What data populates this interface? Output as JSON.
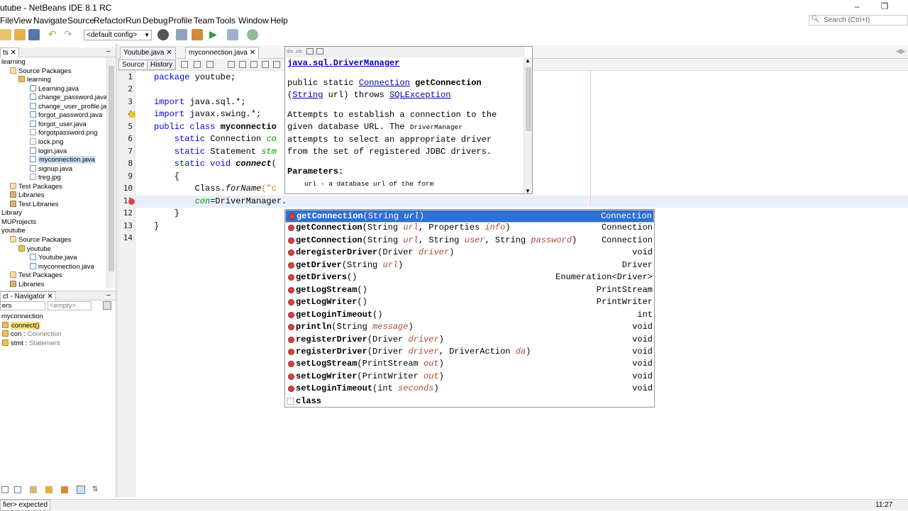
{
  "window": {
    "title": "utube - NetBeans IDE 8.1 RC"
  },
  "menu": [
    "File",
    "View",
    "Navigate",
    "Source",
    "Refactor",
    "Run",
    "Debug",
    "Profile",
    "Team",
    "Tools",
    "Window",
    "Help"
  ],
  "search": {
    "placeholder": "Search (Ctrl+I)"
  },
  "toolbar": {
    "config": "<default config>"
  },
  "projects_panel": {
    "tab": "ts",
    "tree": [
      {
        "label": "learning",
        "icon": "none",
        "indent": 0
      },
      {
        "label": "Source Packages",
        "icon": "package-folder-icon",
        "indent": 1
      },
      {
        "label": "learning",
        "icon": "package-icon",
        "indent": 2
      },
      {
        "label": "Learning.java",
        "icon": "java-file-icon",
        "indent": 3
      },
      {
        "label": "change_password.java",
        "icon": "java-file-icon",
        "indent": 3
      },
      {
        "label": "change_user_profile.java",
        "icon": "java-file-icon",
        "indent": 3
      },
      {
        "label": "forgot_password.java",
        "icon": "java-file-icon",
        "indent": 3
      },
      {
        "label": "forgot_user.java",
        "icon": "java-file-icon",
        "indent": 3
      },
      {
        "label": "forgotpassword.png",
        "icon": "image-file-icon",
        "indent": 3
      },
      {
        "label": "lock.png",
        "icon": "image-file-icon",
        "indent": 3
      },
      {
        "label": "login.java",
        "icon": "java-file-icon",
        "indent": 3
      },
      {
        "label": "myconnection.java",
        "icon": "java-file-icon",
        "indent": 3,
        "selected": true
      },
      {
        "label": "signup.java",
        "icon": "java-file-icon",
        "indent": 3
      },
      {
        "label": "treg.jpg",
        "icon": "image-file-icon",
        "indent": 3
      },
      {
        "label": "Test Packages",
        "icon": "package-folder-icon",
        "indent": 1
      },
      {
        "label": "Libraries",
        "icon": "library-icon",
        "indent": 1
      },
      {
        "label": "Test Libraries",
        "icon": "library-icon",
        "indent": 1
      },
      {
        "label": "Library",
        "icon": "none",
        "indent": 0
      },
      {
        "label": "MUProjects",
        "icon": "none",
        "indent": 0
      },
      {
        "label": "youtube",
        "icon": "none",
        "indent": 0
      },
      {
        "label": "Source Packages",
        "icon": "package-folder-icon",
        "indent": 1
      },
      {
        "label": "youtube",
        "icon": "package-icon",
        "indent": 2
      },
      {
        "label": "Youtube.java",
        "icon": "java-file-icon",
        "indent": 3
      },
      {
        "label": "myconnection.java",
        "icon": "java-file-icon",
        "indent": 3
      },
      {
        "label": "Test Packages",
        "icon": "package-folder-icon",
        "indent": 1
      },
      {
        "label": "Libraries",
        "icon": "library-icon",
        "indent": 1
      }
    ]
  },
  "navigator": {
    "tab": "ct - Navigator",
    "filter1": "ers",
    "filter2": "<empty>",
    "items": [
      {
        "label": "myconnection",
        "type": "",
        "indent": 0
      },
      {
        "label": "connect()",
        "type": "",
        "indent": 1,
        "highlight": true
      },
      {
        "label": "con :",
        "type": "Connection",
        "indent": 1
      },
      {
        "label": "stmt :",
        "type": "Statement",
        "indent": 1
      }
    ]
  },
  "editor": {
    "tabs": [
      {
        "label": "Youtube.java",
        "active": false
      },
      {
        "label": "myconnection.java",
        "active": true
      }
    ],
    "source_label": "Source",
    "history_label": "History",
    "lines": [
      "1",
      "2",
      "3",
      "4",
      "5",
      "6",
      "7",
      "8",
      "9",
      "10",
      "11",
      "12",
      "13",
      "14"
    ],
    "code": {
      "l1a": "package",
      "l1b": " youtube;",
      "l3a": "import",
      "l3b": " java.sql.*;",
      "l4a": "import",
      "l4b": " javax.swing.*;",
      "l5a": "public class",
      "l5b": " ",
      "l5c": "myconnectio",
      "l6a": "    static",
      "l6b": " Connection ",
      "l6c": "co",
      "l7a": "    static",
      "l7b": " Statement ",
      "l7c": "stm",
      "l8a": "    static void",
      "l8b": " ",
      "l8c": "connect",
      "l8d": "(",
      "l9": "    {",
      "l10a": "        Class.",
      "l10b": "forName",
      "l10c": "(\"c",
      "l11a": "        ",
      "l11b": "con",
      "l11c": "=DriverManager.",
      "l12": "    }",
      "l13": "}"
    }
  },
  "javadoc": {
    "class_link": "java.sql.DriverManager",
    "sig1": "public static ",
    "sig_link1": "Connection",
    "sig_name": " getConnection",
    "sig2a": "(",
    "sig_link2": "String",
    "sig2b": " url) throws ",
    "sig_link3": "SQLException",
    "desc1": "Attempts to establish a connection to the",
    "desc2a": "given database URL. The ",
    "desc2b": "DriverManager",
    "desc3": "attempts to select an appropriate driver",
    "desc4": "from the set of registered JDBC drivers.",
    "params_title": "Parameters:",
    "param1a": "url",
    "param1b": " - a database url of the form"
  },
  "completion": [
    {
      "name": "getConnection",
      "params": [
        [
          "String ",
          "url"
        ]
      ],
      "ret": "Connection",
      "selected": true
    },
    {
      "name": "getConnection",
      "params": [
        [
          "String ",
          "url"
        ],
        [
          "Properties ",
          "info"
        ]
      ],
      "ret": "Connection"
    },
    {
      "name": "getConnection",
      "params": [
        [
          "String ",
          "url"
        ],
        [
          "String ",
          "user"
        ],
        [
          "String ",
          "password"
        ]
      ],
      "ret": "Connection"
    },
    {
      "name": "deregisterDriver",
      "params": [
        [
          "Driver ",
          "driver"
        ]
      ],
      "ret": "void"
    },
    {
      "name": "getDriver",
      "params": [
        [
          "String ",
          "url"
        ]
      ],
      "ret": "Driver"
    },
    {
      "name": "getDrivers",
      "params": [],
      "ret": "Enumeration<Driver>"
    },
    {
      "name": "getLogStream",
      "params": [],
      "ret": "PrintStream"
    },
    {
      "name": "getLogWriter",
      "params": [],
      "ret": "PrintWriter"
    },
    {
      "name": "getLoginTimeout",
      "params": [],
      "ret": "int"
    },
    {
      "name": "println",
      "params": [
        [
          "String ",
          "message"
        ]
      ],
      "ret": "void"
    },
    {
      "name": "registerDriver",
      "params": [
        [
          "Driver ",
          "driver"
        ]
      ],
      "ret": "void"
    },
    {
      "name": "registerDriver",
      "params": [
        [
          "Driver ",
          "driver"
        ],
        [
          "DriverAction ",
          "da"
        ]
      ],
      "ret": "void"
    },
    {
      "name": "setLogStream",
      "params": [
        [
          "PrintStream ",
          "out"
        ]
      ],
      "ret": "void"
    },
    {
      "name": "setLogWriter",
      "params": [
        [
          "PrintWriter ",
          "out"
        ]
      ],
      "ret": "void"
    },
    {
      "name": "setLoginTimeout",
      "params": [
        [
          "int ",
          "seconds"
        ]
      ],
      "ret": "void"
    },
    {
      "name": "class",
      "params": null,
      "ret": ""
    }
  ],
  "status": {
    "message": "fier> expected",
    "time": "11:27"
  }
}
